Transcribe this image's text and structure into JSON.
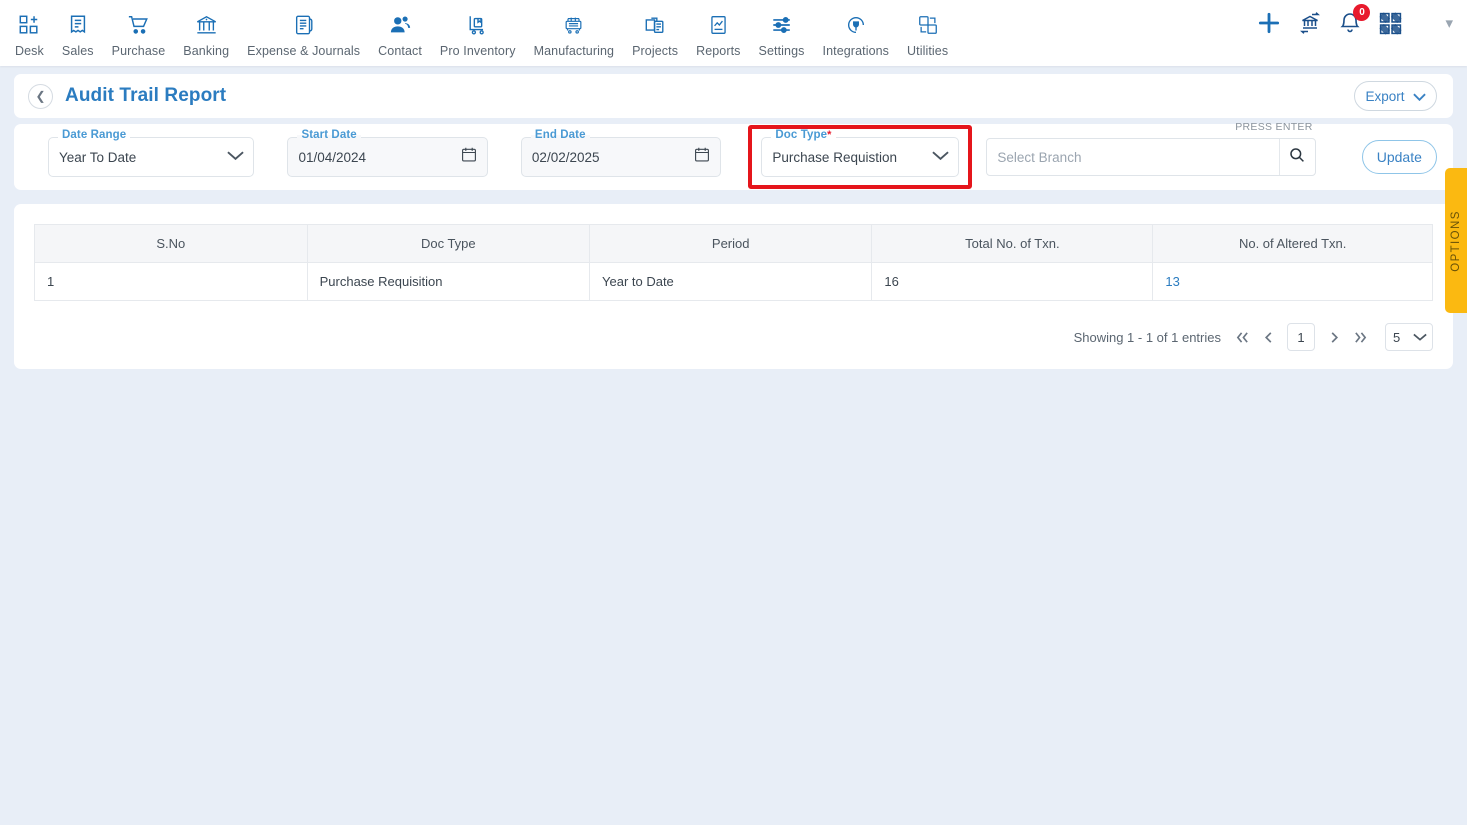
{
  "topnav": {
    "items": [
      {
        "label": "Desk",
        "icon": "dashboard-grid-plus-icon"
      },
      {
        "label": "Sales",
        "icon": "receipt-icon"
      },
      {
        "label": "Purchase",
        "icon": "shopping-cart-icon"
      },
      {
        "label": "Banking",
        "icon": "bank-building-icon"
      },
      {
        "label": "Expense & Journals",
        "icon": "journal-book-icon"
      },
      {
        "label": "Contact",
        "icon": "people-icon"
      },
      {
        "label": "Pro Inventory",
        "icon": "hand-truck-icon"
      },
      {
        "label": "Manufacturing",
        "icon": "machine-icon"
      },
      {
        "label": "Projects",
        "icon": "project-folder-icon"
      },
      {
        "label": "Reports",
        "icon": "report-chart-icon"
      },
      {
        "label": "Settings",
        "icon": "sliders-icon"
      },
      {
        "label": "Integrations",
        "icon": "plug-circle-icon"
      },
      {
        "label": "Utilities",
        "icon": "utilities-swap-icon"
      }
    ],
    "right": {
      "add_icon": "plus-icon",
      "bank_transfer_icon": "bank-transfer-icon",
      "notifications_icon": "bell-icon",
      "notifications_count": "0",
      "apps_icon": "apps-grid-icon",
      "user_menu_icon": "chevron-down-icon"
    }
  },
  "header": {
    "back_icon": "chevron-left-icon",
    "title": "Audit Trail Report",
    "export_label": "Export",
    "export_caret_icon": "chevron-down-icon"
  },
  "filters": {
    "date_range": {
      "label": "Date Range",
      "value": "Year To Date",
      "caret_icon": "chevron-down-icon"
    },
    "start_date": {
      "label": "Start Date",
      "value": "01/04/2024",
      "icon": "calendar-icon"
    },
    "end_date": {
      "label": "End Date",
      "value": "02/02/2025",
      "icon": "calendar-icon"
    },
    "doc_type": {
      "label": "Doc Type",
      "required_mark": "*",
      "value": "Purchase Requistion",
      "caret_icon": "chevron-down-icon",
      "highlight_color": "#e5151b"
    },
    "branch_search": {
      "placeholder": "Select Branch",
      "value": "",
      "hint": "PRESS ENTER",
      "search_icon": "search-icon"
    },
    "update_label": "Update"
  },
  "table": {
    "columns": [
      "S.No",
      "Doc Type",
      "Period",
      "Total No. of Txn.",
      "No. of Altered Txn."
    ],
    "rows": [
      {
        "sno": "1",
        "doc_type": "Purchase Requisition",
        "period": "Year to Date",
        "total_txn": "16",
        "altered_txn": "13"
      }
    ]
  },
  "pagination": {
    "summary": "Showing 1 - 1 of 1 entries",
    "first_icon": "double-chevron-left-icon",
    "prev_icon": "chevron-left-icon",
    "current_page": "1",
    "next_icon": "chevron-right-icon",
    "last_icon": "double-chevron-right-icon",
    "page_size": "5",
    "page_size_caret_icon": "chevron-down-icon"
  },
  "options_tab": {
    "label": "OPTIONS",
    "color": "#fbb911"
  }
}
